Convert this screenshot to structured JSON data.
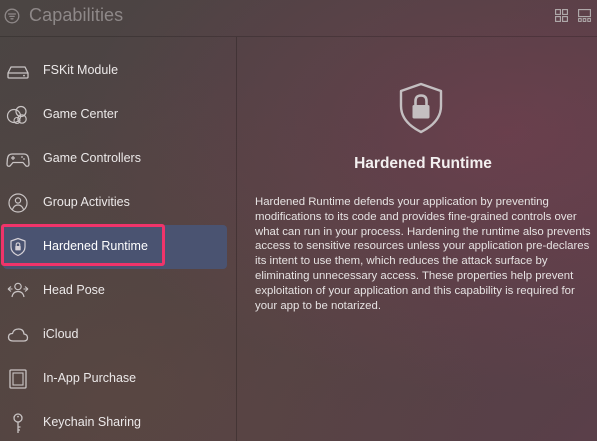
{
  "header": {
    "title": "Capabilities",
    "filter_icon": "filter-circle-icon",
    "grid_icon": "grid-view-icon",
    "gallery_icon": "gallery-view-icon"
  },
  "sidebar": {
    "items": [
      {
        "label": "FSKit Module",
        "icon": "drive-icon",
        "selected": false
      },
      {
        "label": "Game Center",
        "icon": "game-center-icon",
        "selected": false
      },
      {
        "label": "Game Controllers",
        "icon": "game-controller-icon",
        "selected": false
      },
      {
        "label": "Group Activities",
        "icon": "group-activities-icon",
        "selected": false
      },
      {
        "label": "Hardened Runtime",
        "icon": "lock-shield-icon",
        "selected": true
      },
      {
        "label": "Head Pose",
        "icon": "head-pose-icon",
        "selected": false
      },
      {
        "label": "iCloud",
        "icon": "cloud-icon",
        "selected": false
      },
      {
        "label": "In-App Purchase",
        "icon": "in-app-purchase-icon",
        "selected": false
      },
      {
        "label": "Keychain Sharing",
        "icon": "key-icon",
        "selected": false
      }
    ]
  },
  "detail": {
    "icon": "lock-shield-icon",
    "title": "Hardened Runtime",
    "description": "Hardened Runtime defends your application by preventing modifications to its code and provides fine-grained controls over what can run in your process. Hardening the runtime also prevents access to sensitive resources unless your application pre-declares its intent to use them, which reduces the attack surface by eliminating unnecessary access. These properties help prevent exploitation of your application and this capability is required for your app to be notarized."
  },
  "colors": {
    "selection_background": "#4a5371",
    "highlight_ring": "#f0346a",
    "header_title": "#8e8888"
  }
}
